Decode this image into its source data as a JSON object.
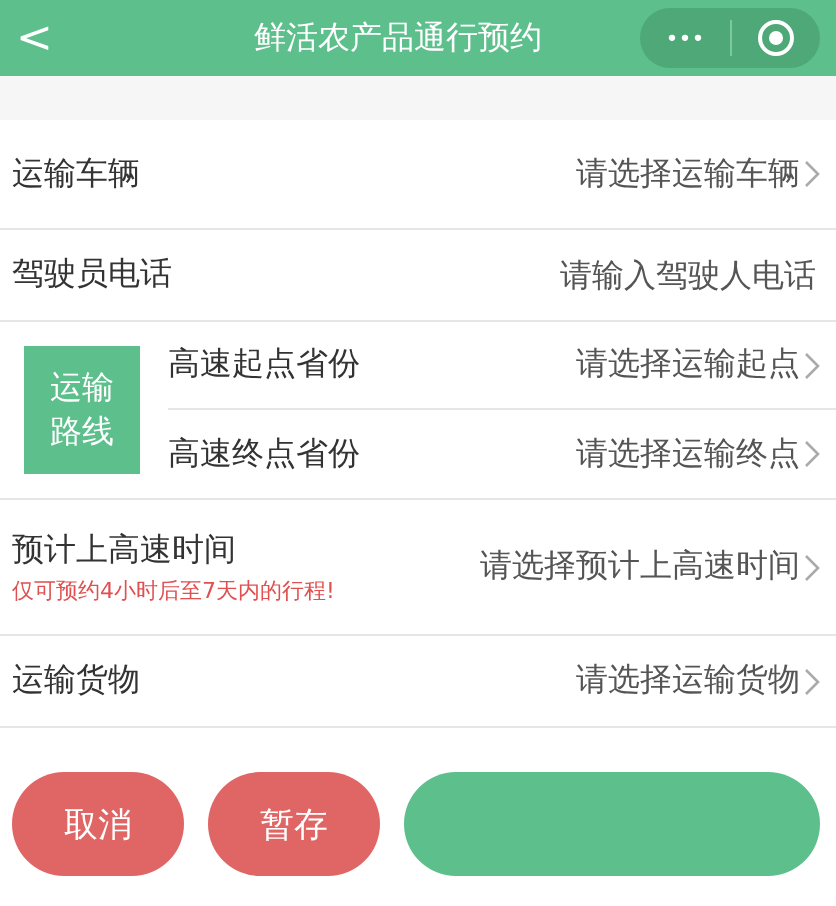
{
  "header": {
    "back": "<",
    "title": "鲜活农产品通行预约",
    "more": "•••"
  },
  "rows_top": [
    {
      "kind": "select",
      "label": "运输车辆",
      "value": "请选择运输车辆"
    },
    {
      "kind": "input",
      "label": "驾驶员电话",
      "placeholder": "请输入驾驶人电话"
    }
  ],
  "route": {
    "badge": [
      "运输",
      "路线"
    ],
    "rows": [
      {
        "kind": "select",
        "label": "高速起点省份",
        "value": "请选择运输起点"
      },
      {
        "kind": "select",
        "label": "高速终点省份",
        "value": "请选择运输终点"
      }
    ]
  },
  "rows_bottom": [
    {
      "kind": "select",
      "label": "预计上高速时间",
      "note": "仅可预约4小时后至7天内的行程!",
      "value": "请选择预计上高速时间"
    },
    {
      "kind": "select",
      "label": "运输货物",
      "value": "请选择运输货物"
    }
  ],
  "buttons": [
    {
      "label": "取消",
      "kind": "cancel"
    },
    {
      "label": "暂存",
      "kind": "cancel"
    },
    {
      "kind": "submit"
    }
  ]
}
